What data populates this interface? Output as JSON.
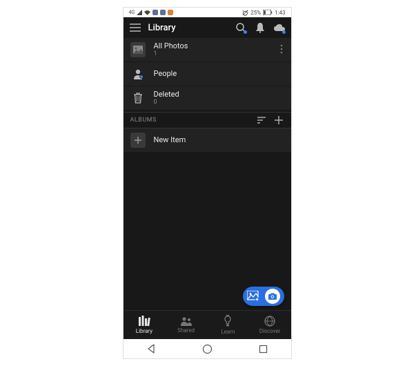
{
  "status": {
    "battery_pct": "25%",
    "time": "1:43"
  },
  "header": {
    "title": "Library"
  },
  "rows": {
    "all_photos": {
      "label": "All Photos",
      "count": "1"
    },
    "people": {
      "label": "People"
    },
    "deleted": {
      "label": "Deleted",
      "count": "0"
    }
  },
  "section": {
    "label": "ALBUMS"
  },
  "albums": {
    "new_item": {
      "label": "New Item"
    }
  },
  "tabs": {
    "library": "Library",
    "shared": "Shared",
    "learn": "Learn",
    "discover": "Discover"
  }
}
